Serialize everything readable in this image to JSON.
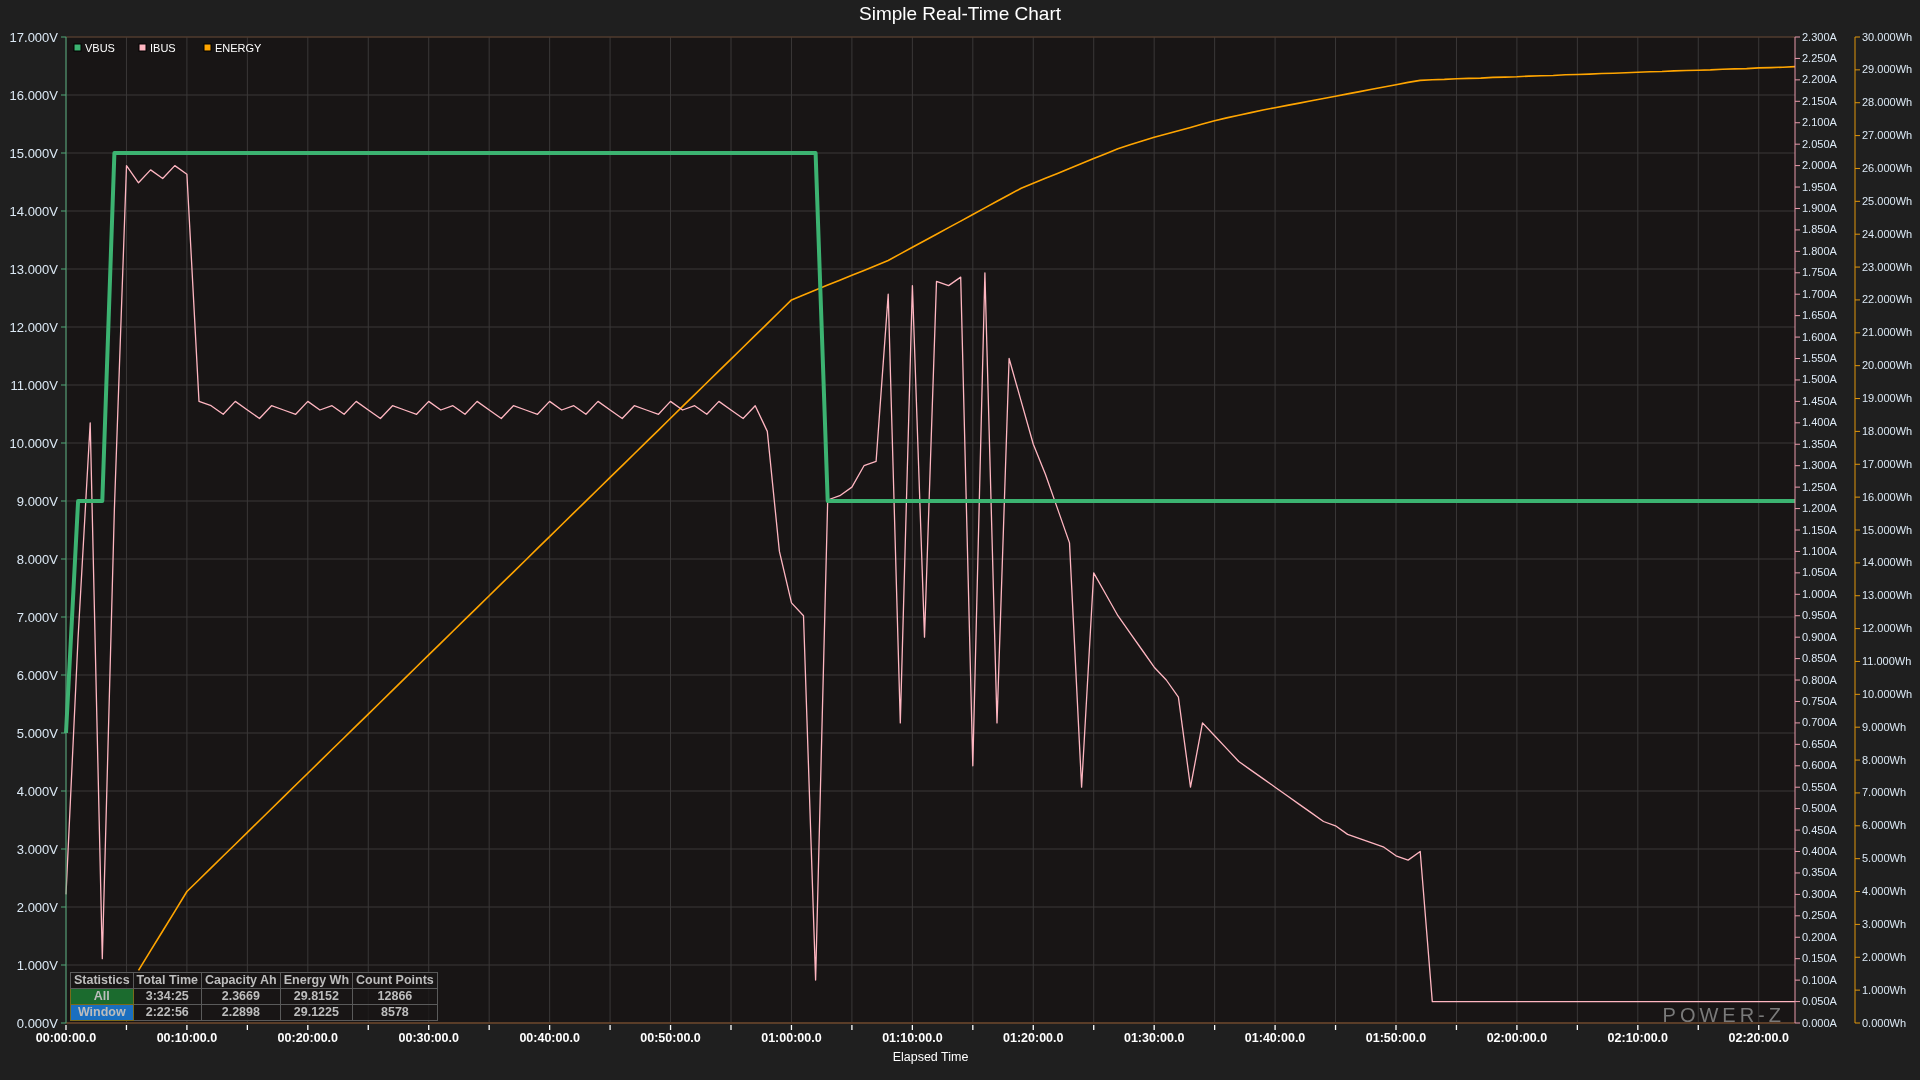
{
  "title": "Simple Real-Time Chart",
  "chart_data": {
    "type": "line",
    "grid": true,
    "legend": true,
    "xlabel": "Elapsed Time",
    "categories": [
      "00:00:00.0",
      null,
      null,
      null,
      null,
      null,
      null,
      null,
      null,
      null,
      "00:10:00.0",
      null,
      null,
      null,
      null,
      null,
      null,
      null,
      null,
      null,
      "00:20:00.0",
      null,
      null,
      null,
      null,
      null,
      null,
      null,
      null,
      null,
      "00:30:00.0",
      null,
      null,
      null,
      null,
      null,
      null,
      null,
      null,
      null,
      "00:40:00.0",
      null,
      null,
      null,
      null,
      null,
      null,
      null,
      null,
      null,
      "00:50:00.0",
      null,
      null,
      null,
      null,
      null,
      null,
      null,
      null,
      null,
      "01:00:00.0",
      null,
      null,
      null,
      null,
      null,
      null,
      null,
      null,
      null,
      "01:10:00.0",
      null,
      null,
      null,
      null,
      null,
      null,
      null,
      null,
      null,
      "01:20:00.0",
      null,
      null,
      null,
      null,
      null,
      null,
      null,
      null,
      null,
      "01:30:00.0",
      null,
      null,
      null,
      null,
      null,
      null,
      null,
      null,
      null,
      "01:40:00.0",
      null,
      null,
      null,
      null,
      null,
      null,
      null,
      null,
      null,
      "01:50:00.0",
      null,
      null,
      null,
      null,
      null,
      null,
      null,
      null,
      null,
      "02:00:00.0",
      null,
      null,
      null,
      null,
      null,
      null,
      null,
      null,
      null,
      "02:10:00.0",
      null,
      null,
      null,
      null,
      null,
      null,
      null,
      null,
      null,
      "02:20:00.0",
      null,
      null,
      null
    ],
    "ylim": [
      0,
      17
    ],
    "yticks": [
      {
        "value": 0,
        "label": "0.000V"
      },
      {
        "value": 1,
        "label": "1.000V"
      },
      {
        "value": 2,
        "label": "2.000V"
      },
      {
        "value": 3,
        "label": "3.000V"
      },
      {
        "value": 4,
        "label": "4.000V"
      },
      {
        "value": 5,
        "label": "5.000V"
      },
      {
        "value": 6,
        "label": "6.000V"
      },
      {
        "value": 7,
        "label": "7.000V"
      },
      {
        "value": 8,
        "label": "8.000V"
      },
      {
        "value": 9,
        "label": "9.000V"
      },
      {
        "value": 10,
        "label": "10.000V"
      },
      {
        "value": 11,
        "label": "11.000V"
      },
      {
        "value": 12,
        "label": "12.000V"
      },
      {
        "value": 13,
        "label": "13.000V"
      },
      {
        "value": 14,
        "label": "14.000V"
      },
      {
        "value": 15,
        "label": "15.000V"
      },
      {
        "value": 16,
        "label": "16.000V"
      },
      {
        "value": 17,
        "label": "17.000V"
      }
    ],
    "y2lim": [
      0,
      2.3
    ],
    "y2ticks": [
      {
        "value": 0,
        "label": "0.000A"
      },
      {
        "value": 0.05,
        "label": "0.050A"
      },
      {
        "value": 0.1,
        "label": "0.100A"
      },
      {
        "value": 0.15,
        "label": "0.150A"
      },
      {
        "value": 0.2,
        "label": "0.200A"
      },
      {
        "value": 0.25,
        "label": "0.250A"
      },
      {
        "value": 0.3,
        "label": "0.300A"
      },
      {
        "value": 0.35,
        "label": "0.350A"
      },
      {
        "value": 0.4,
        "label": "0.400A"
      },
      {
        "value": 0.45,
        "label": "0.450A"
      },
      {
        "value": 0.5,
        "label": "0.500A"
      },
      {
        "value": 0.55,
        "label": "0.550A"
      },
      {
        "value": 0.6,
        "label": "0.600A"
      },
      {
        "value": 0.65,
        "label": "0.650A"
      },
      {
        "value": 0.7,
        "label": "0.700A"
      },
      {
        "value": 0.75,
        "label": "0.750A"
      },
      {
        "value": 0.8,
        "label": "0.800A"
      },
      {
        "value": 0.85,
        "label": "0.850A"
      },
      {
        "value": 0.9,
        "label": "0.900A"
      },
      {
        "value": 0.95,
        "label": "0.950A"
      },
      {
        "value": 1.0,
        "label": "1.000A"
      },
      {
        "value": 1.05,
        "label": "1.050A"
      },
      {
        "value": 1.1,
        "label": "1.100A"
      },
      {
        "value": 1.15,
        "label": "1.150A"
      },
      {
        "value": 1.2,
        "label": "1.200A"
      },
      {
        "value": 1.25,
        "label": "1.250A"
      },
      {
        "value": 1.3,
        "label": "1.300A"
      },
      {
        "value": 1.35,
        "label": "1.350A"
      },
      {
        "value": 1.4,
        "label": "1.400A"
      },
      {
        "value": 1.45,
        "label": "1.450A"
      },
      {
        "value": 1.5,
        "label": "1.500A"
      },
      {
        "value": 1.55,
        "label": "1.550A"
      },
      {
        "value": 1.6,
        "label": "1.600A"
      },
      {
        "value": 1.65,
        "label": "1.650A"
      },
      {
        "value": 1.7,
        "label": "1.700A"
      },
      {
        "value": 1.75,
        "label": "1.750A"
      },
      {
        "value": 1.8,
        "label": "1.800A"
      },
      {
        "value": 1.85,
        "label": "1.850A"
      },
      {
        "value": 1.9,
        "label": "1.900A"
      },
      {
        "value": 1.95,
        "label": "1.950A"
      },
      {
        "value": 2.0,
        "label": "2.000A"
      },
      {
        "value": 2.05,
        "label": "2.050A"
      },
      {
        "value": 2.1,
        "label": "2.100A"
      },
      {
        "value": 2.15,
        "label": "2.150A"
      },
      {
        "value": 2.2,
        "label": "2.200A"
      },
      {
        "value": 2.25,
        "label": "2.250A"
      },
      {
        "value": 2.3,
        "label": "2.300A"
      }
    ],
    "y3lim": [
      0,
      30
    ],
    "y3ticks": [
      {
        "value": 0,
        "label": "0.000Wh"
      },
      {
        "value": 1,
        "label": "1.000Wh"
      },
      {
        "value": 2,
        "label": "2.000Wh"
      },
      {
        "value": 3,
        "label": "3.000Wh"
      },
      {
        "value": 4,
        "label": "4.000Wh"
      },
      {
        "value": 5,
        "label": "5.000Wh"
      },
      {
        "value": 6,
        "label": "6.000Wh"
      },
      {
        "value": 7,
        "label": "7.000Wh"
      },
      {
        "value": 8,
        "label": "8.000Wh"
      },
      {
        "value": 9,
        "label": "9.000Wh"
      },
      {
        "value": 10,
        "label": "10.000Wh"
      },
      {
        "value": 11,
        "label": "11.000Wh"
      },
      {
        "value": 12,
        "label": "12.000Wh"
      },
      {
        "value": 13,
        "label": "13.000Wh"
      },
      {
        "value": 14,
        "label": "14.000Wh"
      },
      {
        "value": 15,
        "label": "15.000Wh"
      },
      {
        "value": 16,
        "label": "16.000Wh"
      },
      {
        "value": 17,
        "label": "17.000Wh"
      },
      {
        "value": 18,
        "label": "18.000Wh"
      },
      {
        "value": 19,
        "label": "19.000Wh"
      },
      {
        "value": 20,
        "label": "20.000Wh"
      },
      {
        "value": 21,
        "label": "21.000Wh"
      },
      {
        "value": 22,
        "label": "22.000Wh"
      },
      {
        "value": 23,
        "label": "23.000Wh"
      },
      {
        "value": 24,
        "label": "24.000Wh"
      },
      {
        "value": 25,
        "label": "25.000Wh"
      },
      {
        "value": 26,
        "label": "26.000Wh"
      },
      {
        "value": 27,
        "label": "27.000Wh"
      },
      {
        "value": 28,
        "label": "28.000Wh"
      },
      {
        "value": 29,
        "label": "29.000Wh"
      },
      {
        "value": 30,
        "label": "30.000Wh"
      }
    ],
    "series": [
      {
        "name": "VBUS",
        "color": "#3cb371",
        "axis": "y",
        "values": [
          5,
          9,
          9,
          9,
          15,
          15,
          15,
          15,
          15,
          15,
          15,
          15,
          15,
          15,
          15,
          15,
          15,
          15,
          15,
          15,
          15,
          15,
          15,
          15,
          15,
          15,
          15,
          15,
          15,
          15,
          15,
          15,
          15,
          15,
          15,
          15,
          15,
          15,
          15,
          15,
          15,
          15,
          15,
          15,
          15,
          15,
          15,
          15,
          15,
          15,
          15,
          15,
          15,
          15,
          15,
          15,
          15,
          15,
          15,
          15,
          15,
          15,
          15,
          9,
          9,
          9,
          9,
          9,
          9,
          9,
          9,
          9,
          9,
          9,
          9,
          9,
          9,
          9,
          9,
          9,
          9,
          9,
          9,
          9,
          9,
          9,
          9,
          9,
          9,
          9,
          9,
          9,
          9,
          9,
          9,
          9,
          9,
          9,
          9,
          9,
          9,
          9,
          9,
          9,
          9,
          9,
          9,
          9,
          9,
          9,
          9,
          9,
          9,
          9,
          9,
          9,
          9,
          9,
          9,
          9,
          9,
          9,
          9,
          9,
          9,
          9,
          9,
          9,
          9,
          9,
          9,
          9,
          9,
          9,
          9,
          9,
          9,
          9,
          9,
          9,
          9,
          9,
          9,
          9
        ]
      },
      {
        "name": "IBUS",
        "color": "#ffb6c1",
        "axis": "y2",
        "values": [
          0.3,
          0.9,
          1.4,
          0.15,
          1.2,
          2.0,
          1.96,
          1.99,
          1.97,
          2.0,
          1.98,
          1.45,
          1.44,
          1.42,
          1.45,
          1.43,
          1.41,
          1.44,
          1.43,
          1.42,
          1.45,
          1.43,
          1.44,
          1.42,
          1.45,
          1.43,
          1.41,
          1.44,
          1.43,
          1.42,
          1.45,
          1.43,
          1.44,
          1.42,
          1.45,
          1.43,
          1.41,
          1.44,
          1.43,
          1.42,
          1.45,
          1.43,
          1.44,
          1.42,
          1.45,
          1.43,
          1.41,
          1.44,
          1.43,
          1.42,
          1.45,
          1.43,
          1.44,
          1.42,
          1.45,
          1.43,
          1.41,
          1.44,
          1.38,
          1.1,
          0.98,
          0.95,
          0.1,
          1.22,
          1.23,
          1.25,
          1.3,
          1.31,
          1.7,
          0.7,
          1.72,
          0.9,
          1.73,
          1.72,
          1.74,
          0.6,
          1.75,
          0.7,
          1.55,
          1.45,
          1.35,
          1.28,
          1.2,
          1.12,
          0.55,
          1.05,
          1.0,
          0.95,
          0.91,
          0.87,
          0.83,
          0.8,
          0.76,
          0.55,
          0.7,
          0.67,
          0.64,
          0.61,
          0.59,
          0.57,
          0.55,
          0.53,
          0.51,
          0.49,
          0.47,
          0.46,
          0.44,
          0.43,
          0.42,
          0.41,
          0.39,
          0.38,
          0.4,
          0.05,
          0.05,
          0.05,
          0.05,
          0.05,
          0.05,
          0.05,
          0.05,
          0.05,
          0.05,
          0.05,
          0.05,
          0.05,
          0.05,
          0.05,
          0.05,
          0.05,
          0.05,
          0.05,
          0.05,
          0.05,
          0.05,
          0.05,
          0.05,
          0.05,
          0.05,
          0.05,
          0.05,
          0.05,
          0.05,
          0.05
        ]
      },
      {
        "name": "ENERGY",
        "color": "#ffa500",
        "axis": "y3",
        "values": [
          null,
          null,
          null,
          null,
          null,
          null,
          1.6,
          2.2,
          2.8,
          3.4,
          4.0,
          4.36,
          4.72,
          5.08,
          5.44,
          5.8,
          6.16,
          6.52,
          6.88,
          7.24,
          7.6,
          7.96,
          8.32,
          8.68,
          9.04,
          9.4,
          9.76,
          10.12,
          10.48,
          10.84,
          11.2,
          11.56,
          11.92,
          12.28,
          12.64,
          13.0,
          13.36,
          13.72,
          14.08,
          14.44,
          14.8,
          15.16,
          15.52,
          15.88,
          16.24,
          16.6,
          16.96,
          17.32,
          17.68,
          18.04,
          18.4,
          18.76,
          19.12,
          19.48,
          19.84,
          20.2,
          20.56,
          20.92,
          21.28,
          21.64,
          22.0,
          22.15,
          22.3,
          22.45,
          22.6,
          22.75,
          22.9,
          23.05,
          23.2,
          23.4,
          23.6,
          23.8,
          24.0,
          24.2,
          24.4,
          24.6,
          24.8,
          25.0,
          25.2,
          25.4,
          25.55,
          25.7,
          25.85,
          26.0,
          26.15,
          26.3,
          26.45,
          26.6,
          26.72,
          26.84,
          26.95,
          27.05,
          27.15,
          27.25,
          27.35,
          27.45,
          27.54,
          27.62,
          27.7,
          27.78,
          27.85,
          27.92,
          27.99,
          28.06,
          28.13,
          28.2,
          28.27,
          28.34,
          28.41,
          28.48,
          28.55,
          28.62,
          28.68,
          28.7,
          28.71,
          28.73,
          28.74,
          28.75,
          28.77,
          28.78,
          28.79,
          28.81,
          28.82,
          28.83,
          28.85,
          28.86,
          28.87,
          28.89,
          28.9,
          28.91,
          28.93,
          28.94,
          28.95,
          28.97,
          28.98,
          28.99,
          29.0,
          29.02,
          29.03,
          29.04,
          29.06,
          29.07,
          29.08,
          29.1
        ]
      }
    ]
  },
  "statistics": {
    "columns": [
      "Statistics",
      "Total Time",
      "Capacity Ah",
      "Energy Wh",
      "Count Points"
    ],
    "rows": [
      {
        "color": "#1b6b2e",
        "cells": [
          "All",
          "3:34:25",
          "2.3669",
          "29.8152",
          "12866"
        ]
      },
      {
        "color": "#1a6fc0",
        "cells": [
          "Window",
          "2:22:56",
          "2.2898",
          "29.1225",
          "8578"
        ]
      }
    ]
  },
  "logo": "POWER-Z"
}
